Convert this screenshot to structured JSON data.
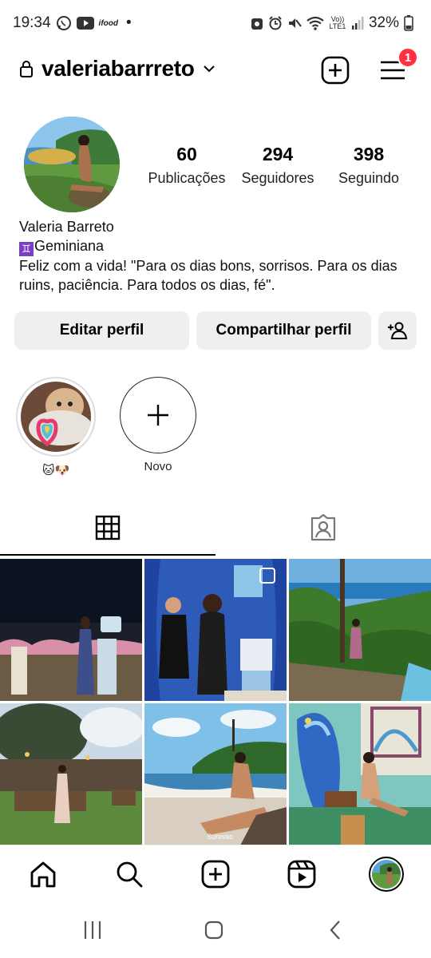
{
  "status_bar": {
    "time": "19:34",
    "app_icons": [
      "whatsapp-icon",
      "youtube-icon",
      "ifood-icon"
    ],
    "ifood_text": "ifood",
    "dot": "•",
    "network": "Vo)) LTE1",
    "battery": "32%"
  },
  "header": {
    "username": "valeriabarrreto",
    "notification_count": "1"
  },
  "profile": {
    "stats": [
      {
        "value": "60",
        "label": "Publicações"
      },
      {
        "value": "294",
        "label": "Seguidores"
      },
      {
        "value": "398",
        "label": "Seguindo"
      }
    ],
    "name": "Valeria Barreto",
    "zodiac_symbol": "♊",
    "sign": "Geminiana",
    "bio": "Feliz com a vida! \"Para os dias bons, sorrisos. Para os dias ruins, paciência. Para todos os dias, fé\"."
  },
  "buttons": {
    "edit": "Editar perfil",
    "share": "Compartilhar perfil"
  },
  "highlights": [
    {
      "label": "🐱🐶"
    },
    {
      "label": "Novo"
    }
  ],
  "tabs": [
    "grid-icon",
    "tagged-icon"
  ],
  "posts_watermark": "Suresso",
  "colors": {
    "badge": "#ff3040",
    "button_bg": "#efefef"
  }
}
